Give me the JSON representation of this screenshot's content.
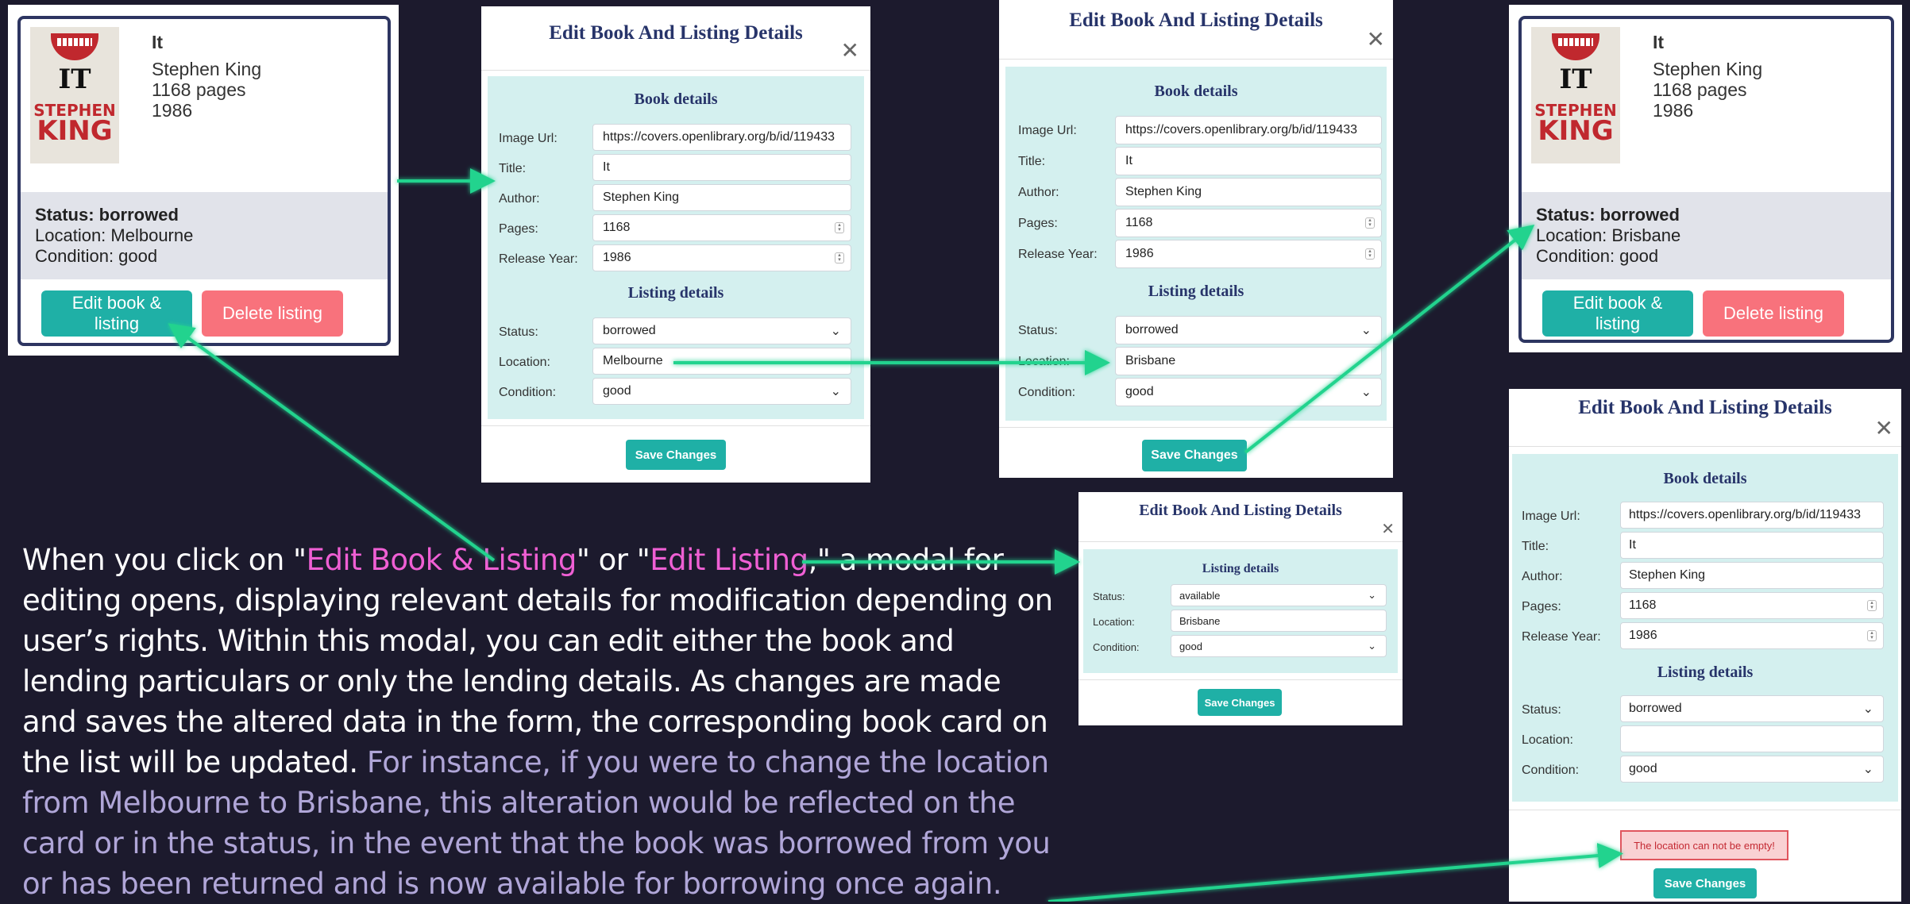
{
  "card_before": {
    "title": "It",
    "author": "Stephen King",
    "pages": "1168 pages",
    "year": "1986",
    "status": "Status: borrowed",
    "location": "Location: Melbourne",
    "condition": "Condition: good",
    "edit_label": "Edit book & listing",
    "delete_label": "Delete listing",
    "cover": {
      "title": "IT",
      "author_line1": "STEPHEN",
      "author_line2": "KING"
    }
  },
  "card_after": {
    "title": "It",
    "author": "Stephen King",
    "pages": "1168 pages",
    "year": "1986",
    "status": "Status: borrowed",
    "location": "Location: Brisbane",
    "condition": "Condition: good",
    "edit_label": "Edit book & listing",
    "delete_label": "Delete listing",
    "cover": {
      "title": "IT",
      "author_line1": "STEPHEN",
      "author_line2": "KING"
    }
  },
  "modal_full_a": {
    "title": "Edit Book And Listing Details",
    "book_section": "Book details",
    "listing_section": "Listing details",
    "labels": {
      "image": "Image Url:",
      "title": "Title:",
      "author": "Author:",
      "pages": "Pages:",
      "year": "Release Year:",
      "status": "Status:",
      "location": "Location:",
      "condition": "Condition:"
    },
    "values": {
      "image": "https://covers.openlibrary.org/b/id/119433",
      "title": "It",
      "author": "Stephen King",
      "pages": "1168",
      "year": "1986",
      "status": "borrowed",
      "location": "Melbourne",
      "condition": "good"
    },
    "save": "Save Changes"
  },
  "modal_full_b": {
    "title": "Edit Book And Listing Details",
    "book_section": "Book details",
    "listing_section": "Listing details",
    "labels": {
      "image": "Image Url:",
      "title": "Title:",
      "author": "Author:",
      "pages": "Pages:",
      "year": "Release Year:",
      "status": "Status:",
      "location": "Location:",
      "condition": "Condition:"
    },
    "values": {
      "image": "https://covers.openlibrary.org/b/id/119433",
      "title": "It",
      "author": "Stephen King",
      "pages": "1168",
      "year": "1986",
      "status": "borrowed",
      "location": "Brisbane",
      "condition": "good"
    },
    "save": "Save Changes"
  },
  "modal_listing": {
    "title": "Edit Book And Listing Details",
    "listing_section": "Listing details",
    "labels": {
      "status": "Status:",
      "location": "Location:",
      "condition": "Condition:"
    },
    "values": {
      "status": "available",
      "location": "Brisbane",
      "condition": "good"
    },
    "save": "Save Changes"
  },
  "modal_error": {
    "title": "Edit Book And Listing Details",
    "book_section": "Book details",
    "listing_section": "Listing details",
    "labels": {
      "image": "Image Url:",
      "title": "Title:",
      "author": "Author:",
      "pages": "Pages:",
      "year": "Release Year:",
      "status": "Status:",
      "location": "Location:",
      "condition": "Condition:"
    },
    "values": {
      "image": "https://covers.openlibrary.org/b/id/119433",
      "title": "It",
      "author": "Stephen King",
      "pages": "1168",
      "year": "1986",
      "status": "borrowed",
      "location": "",
      "condition": "good"
    },
    "error": "The location can not be empty!",
    "save": "Save Changes"
  },
  "description": {
    "p1": "When you click on \"",
    "hl1": "Edit Book & Listing",
    "p2": "\" or \"",
    "hl2": "Edit Listing",
    "p3": ",\" a modal for editing opens, displaying relevant details for modification depending on user’s rights. Within this modal, you can edit either the book and lending particulars or only the lending details. As changes are made and saves the altered data in the form, the corresponding book card on the list will be updated. ",
    "soft": "For instance, if you were to change the location from Melbourne to Brisbane, this alteration would be reflected on the card or in the status, in the event that the book was borrowed from you or has been returned and is now available for borrowing once again."
  },
  "colors": {
    "background": "#1c1a2d",
    "accent": "#1fb0a6",
    "danger": "#f8727c",
    "highlight": "#ef5fd4",
    "arrow": "#22d38e"
  }
}
